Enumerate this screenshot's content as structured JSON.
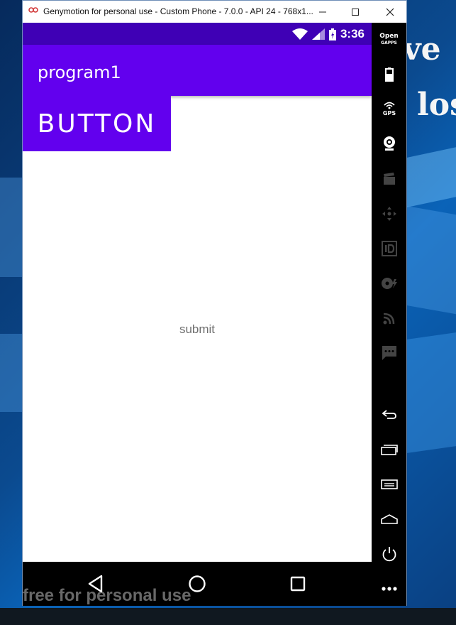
{
  "window": {
    "title": "Genymotion for personal use - Custom Phone - 7.0.0 - API 24 - 768x1...",
    "minimize_icon": "minimize-icon",
    "maximize_icon": "maximize-icon",
    "close_icon": "close-icon"
  },
  "desktop": {
    "bg_text_1": "ve",
    "bg_text_2": "los"
  },
  "status_bar": {
    "time": "3:36",
    "icons": [
      "wifi-icon",
      "cell-signal-icon",
      "battery-icon"
    ]
  },
  "app_bar": {
    "title": "program1"
  },
  "main": {
    "button_label": "BUTTON",
    "submit_text": "submit"
  },
  "nav_bar": {
    "icons": [
      "back-icon",
      "home-icon",
      "recents-icon"
    ]
  },
  "toolbar": {
    "opengapps_line1": "Open",
    "opengapps_line2": "GAPPS",
    "gps_label": "GPS",
    "items": [
      "opengapps-icon",
      "battery-icon",
      "gps-icon",
      "webcam-icon",
      "capture-icon",
      "dpad-icon",
      "id-icon",
      "disk-io-icon",
      "cast-icon",
      "sms-icon",
      "back-icon",
      "recents-icon",
      "menu-icon",
      "home-icon",
      "power-icon",
      "more-icon"
    ]
  },
  "watermark": "free for personal use",
  "colors": {
    "primary": "#6200ee",
    "primary_dark": "#3f00b5"
  }
}
